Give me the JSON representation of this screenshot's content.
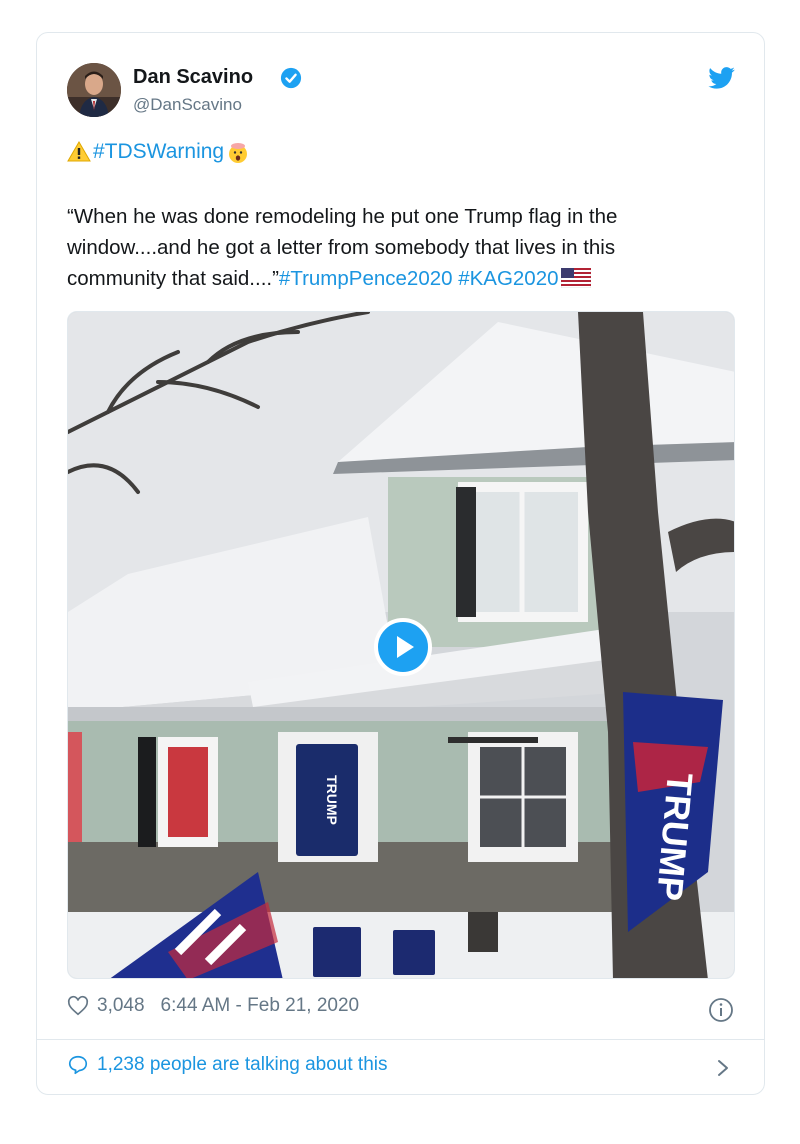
{
  "tweet": {
    "author_name": "Dan Scavino",
    "handle": "@DanScavino",
    "hashtag_line": "#TDSWarning",
    "text_lines": [
      "“When he was done remodeling he put one Trump flag in the",
      "window....and he got a letter from somebody that lives in this",
      "community that said....”"
    ],
    "hashtags": "#TrumpPence2020 #KAG2020",
    "likes": "3,048",
    "timestamp": "6:44 AM - Feb 21, 2020",
    "talking": "1,238 people are talking about this"
  },
  "media": {
    "type": "video",
    "sign_text": "TRUMP",
    "flag_text": "TRUMP"
  },
  "colors": {
    "link": "#1b95e0",
    "text": "#14171a",
    "muted": "#657786",
    "border": "#e1e8ed"
  },
  "icons": [
    "verified-badge-icon",
    "twitter-bird-icon",
    "warning-icon",
    "mind-blown-emoji-icon",
    "us-flag-icon",
    "play-icon",
    "heart-icon",
    "info-icon",
    "speech-bubble-icon",
    "chevron-right-icon"
  ]
}
